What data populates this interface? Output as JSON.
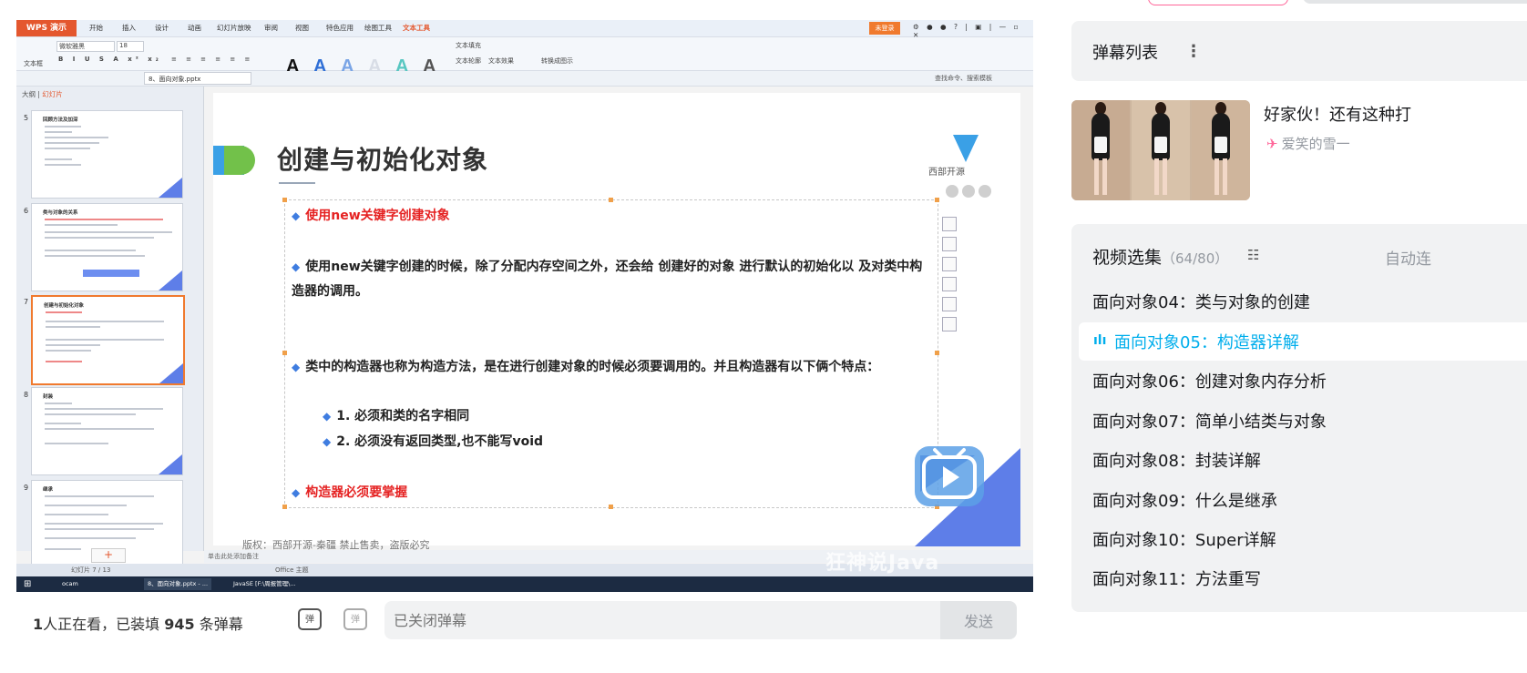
{
  "player": {
    "wps": {
      "logo": "WPS 演示",
      "menu_tabs": [
        "开始",
        "插入",
        "设计",
        "动画",
        "幻灯片放映",
        "审阅",
        "视图",
        "特色应用",
        "绘图工具",
        "文本工具"
      ],
      "login": "未登录",
      "ribbon": {
        "font_name": "微软雅黑",
        "font_size": "18",
        "textbox": "文本框",
        "text_fill": "文本填充",
        "text_outline": "文本轮廓",
        "text_effect": "文本效果",
        "convert": "转换成图示"
      },
      "doc_tab": "8、面向对象.pptx",
      "search": "查找命令、搜索模板",
      "panel_tabs": [
        "大纲",
        "幻灯片"
      ],
      "thumbnails": [
        {
          "num": "5",
          "title": "回顾方法及加深"
        },
        {
          "num": "6",
          "title": "类与对象的关系"
        },
        {
          "num": "7",
          "title": "创建与初始化对象"
        },
        {
          "num": "8",
          "title": "封装"
        },
        {
          "num": "9",
          "title": "继承"
        }
      ],
      "add_slide": "+",
      "notes": "单击此处添加备注",
      "status_slide": "幻灯片 7 / 13",
      "status_theme": "Office 主题",
      "taskbar": [
        "ocam",
        "8、面向对象.pptx - ...",
        "JavaSE [F:\\周报管理\\..."
      ]
    },
    "slide": {
      "title": "创建与初始化对象",
      "logo_text": "西部开源",
      "bullets": [
        {
          "text": "使用new关键字创建对象",
          "red": true
        },
        {
          "text": "使用new关键字创建的时候，除了分配内存空间之外，还会给 创建好的对象 进行默认的初始化以 及对类中构造器的调用。",
          "red": false
        },
        {
          "text": "类中的构造器也称为构造方法，是在进行创建对象的时候必须要调用的。并且构造器有以下俩个特点：",
          "red": false
        },
        {
          "text": "1. 必须和类的名字相同",
          "red": false
        },
        {
          "text": "2. 必须没有返回类型,也不能写void",
          "red": false
        },
        {
          "text": "构造器必须要掌握",
          "red": true
        }
      ],
      "footer": "版权：西部开源-秦疆    禁止售卖，盗版必究"
    },
    "watermark": "狂神说Java"
  },
  "bottom_bar": {
    "viewers_count": "1",
    "viewers_text": "人正在看，已装填",
    "danmaku_count": "945",
    "danmaku_suffix": "条弹幕",
    "toggle_icon": "弹",
    "settings_icon": "弹",
    "input_placeholder": "已关闭弹幕",
    "send": "发送"
  },
  "sidebar": {
    "danmaku_list_title": "弹幕列表",
    "recommend": {
      "title": "好家伙！还有这种打",
      "author": "爱笑的雪一"
    },
    "playlist": {
      "title": "视频选集",
      "count": "（64/80）",
      "autoplay": "自动连",
      "episodes": [
        "面向对象04：类与对象的创建",
        "面向对象05：构造器详解",
        "面向对象06：创建对象内存分析",
        "面向对象07：简单小结类与对象",
        "面向对象08：封装详解",
        "面向对象09：什么是继承",
        "面向对象10：Super详解",
        "面向对象11：方法重写"
      ],
      "active_index": 1
    }
  },
  "colors": {
    "accent": "#00aeec",
    "pink": "#ff6699",
    "wps_orange": "#e4572e",
    "slide_blue": "#5e7ee8"
  }
}
